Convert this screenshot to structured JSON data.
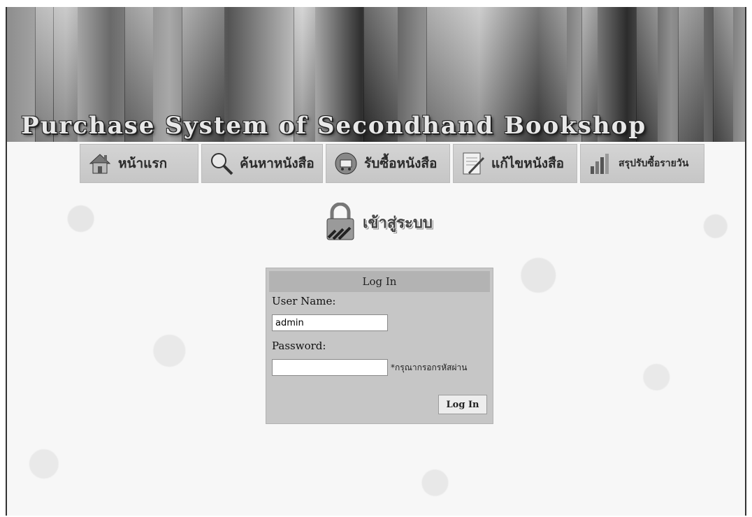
{
  "banner": {
    "title": "Purchase System of Secondhand Bookshop"
  },
  "nav": {
    "items": [
      {
        "label": "หน้าแรก",
        "icon": "house-icon"
      },
      {
        "label": "ค้นหาหนังสือ",
        "icon": "magnifier-icon"
      },
      {
        "label": "รับซื้อหนังสือ",
        "icon": "cart-icon"
      },
      {
        "label": "แก้ไขหนังสือ",
        "icon": "notepad-pencil-icon"
      },
      {
        "label": "สรุปรับซื้อรายวัน",
        "icon": "bar-chart-icon"
      }
    ]
  },
  "login_header": {
    "label": "เข้าสู่ระบบ",
    "icon": "padlock-icon"
  },
  "login": {
    "title": "Log In",
    "username_label": "User Name:",
    "username_value": "admin",
    "password_label": "Password:",
    "password_value": "",
    "password_hint": "*กรุณากรอกรหัสผ่าน",
    "submit_label": "Log In"
  }
}
